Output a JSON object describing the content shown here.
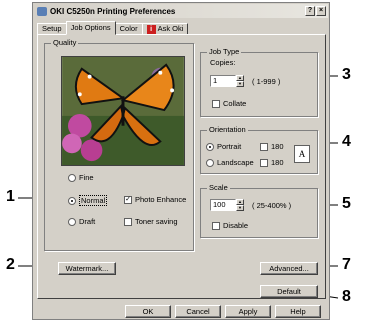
{
  "window": {
    "title": "OKI C5250n Printing Preferences",
    "help_btn": "?",
    "close_btn": "×"
  },
  "tabs": [
    {
      "label": "Setup"
    },
    {
      "label": "Job Options"
    },
    {
      "label": "Color"
    },
    {
      "label": "Ask Oki",
      "icon": "i"
    }
  ],
  "quality": {
    "label": "Quality",
    "fine": "Fine",
    "normal": "Normal",
    "draft": "Draft",
    "photo_enhance": "Photo Enhance",
    "toner_saving": "Toner saving"
  },
  "job_type": {
    "label": "Job Type",
    "copies_label": "Copies:",
    "copies_value": "1",
    "range": "( 1-999 )",
    "collate": "Collate"
  },
  "orientation": {
    "label": "Orientation",
    "portrait": "Portrait",
    "landscape": "Landscape",
    "rot180_a": "180",
    "rot180_b": "180",
    "preview_letter": "A"
  },
  "scale": {
    "label": "Scale",
    "value": "100",
    "range": "( 25-400% )",
    "disable": "Disable"
  },
  "buttons": {
    "watermark": "Watermark...",
    "advanced": "Advanced...",
    "default": "Default",
    "ok": "OK",
    "cancel": "Cancel",
    "apply": "Apply",
    "help": "Help"
  },
  "callouts": [
    "1",
    "2",
    "3",
    "4",
    "5",
    "7",
    "8"
  ]
}
